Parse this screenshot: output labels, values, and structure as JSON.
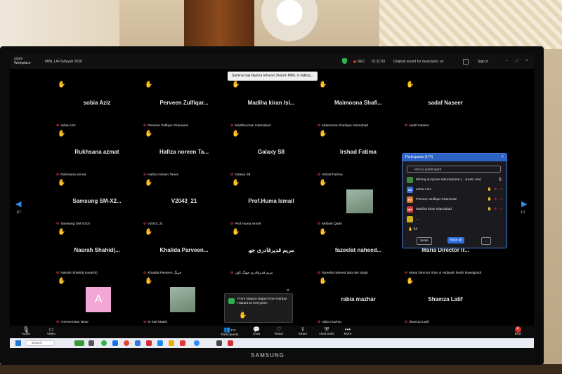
{
  "app": {
    "logo_line1": "zoom",
    "logo_line2": "Workplace",
    "meeting_title": "MWL | Al-Tarbiyah 2026",
    "rec_label": "REC",
    "timer": "01:11:09",
    "sound_label": "Original sound for musicians: on",
    "signin_label": "Sign in",
    "talking_banner": "Samina baji Nazma tehseel Jhelum MWL is talking..."
  },
  "pages": {
    "left": "1/7",
    "right": "1/7"
  },
  "tiles": [
    {
      "name": "sobia Aziz",
      "label": "sobia Aziz"
    },
    {
      "name": "Perveen Zulfiqar...",
      "label": "Perveen Zulfiqar Khanewal"
    },
    {
      "name": "Madiha kiran Isl...",
      "label": "Madiha kiran Islamabad"
    },
    {
      "name": "Maimoona Shafi...",
      "label": "Maimoona Shafique islamabad"
    },
    {
      "name": "sadaf Naseer",
      "label": "sadaf Naseer"
    },
    {
      "name": "Rukhsana azmat",
      "label": "Rukhsana azmat"
    },
    {
      "name": "Hafiza noreen Ta...",
      "label": "Hafiza noreen Tanvir"
    },
    {
      "name": "Galaxy S8",
      "label": "Galaxy S8"
    },
    {
      "name": "Irshad Fatima",
      "label": "Irshad Fatima"
    },
    {
      "name": "Samsung SM-X2...",
      "label": "Samsung SM-X210"
    },
    {
      "name": "V2043_21",
      "label": "V2043_21"
    },
    {
      "name": "Prof.Huma Ismail",
      "label": "Prof.Huma Ismail"
    },
    {
      "name": "",
      "label": "Misbah Qadri"
    },
    {
      "name": "Nasrah Shahid(...",
      "label": "Nasrah Shahid( Karachi)"
    },
    {
      "name": "Khalida Parveen...",
      "label": "Khalida Parveen جہنگ"
    },
    {
      "name": "مریم قدیرقادری جھ",
      "label": "مریم قدیرقادری جھنگ ٹاؤن"
    },
    {
      "name": "fazeelat naheed...",
      "label": "fazeelat naheed taba tek singh"
    },
    {
      "name": "Maria Director Ir...",
      "label": "Maria Director Irfan ul Hidayah North Rawalpindi"
    },
    {
      "name": "",
      "label": "Amreennisar Nisar"
    },
    {
      "name": "",
      "label": "M Saif Madni"
    },
    {
      "name": "rabia mazhar",
      "label": "rabia mazhar"
    },
    {
      "name": "Shamza Latif",
      "label": "Shamza Latif"
    }
  ],
  "avatar_letter": "A",
  "participants_panel": {
    "title": "Participants (174)",
    "search_placeholder": "Find a participant",
    "rows": [
      {
        "initials": "",
        "name": "Minhaj-ul-Quran International (... (Host, me)",
        "color": "#3a8a3a"
      },
      {
        "initials": "SA",
        "name": "sobia Aziz",
        "color": "#3a6fd8"
      },
      {
        "initials": "PZ",
        "name": "Perveen Zulfiqar Khanewal",
        "color": "#e07a2a"
      },
      {
        "initials": "MKI",
        "name": "Madiha kiran Islamabad",
        "color": "#d13a3a"
      },
      {
        "initials": "",
        "name": "...",
        "color": "#d0b020"
      }
    ],
    "hand_count": "54",
    "invite_label": "Invite",
    "mute_all_label": "Mute all",
    "more_label": "..."
  },
  "chat_popup": {
    "text": "From Nayyra Najam from Haripur Hazara to everyone:"
  },
  "toolbar": {
    "audio": "Audio",
    "video": "Video",
    "participants": "Participants",
    "participants_count": "174",
    "chat": "Chat",
    "react": "React",
    "share": "Share",
    "host_tools": "Host tools",
    "more": "More",
    "end": "End"
  },
  "taskbar": {
    "search_placeholder": "Search",
    "clock_time": "",
    "clock_date": ""
  },
  "monitor_brand": "SAMSUNG"
}
